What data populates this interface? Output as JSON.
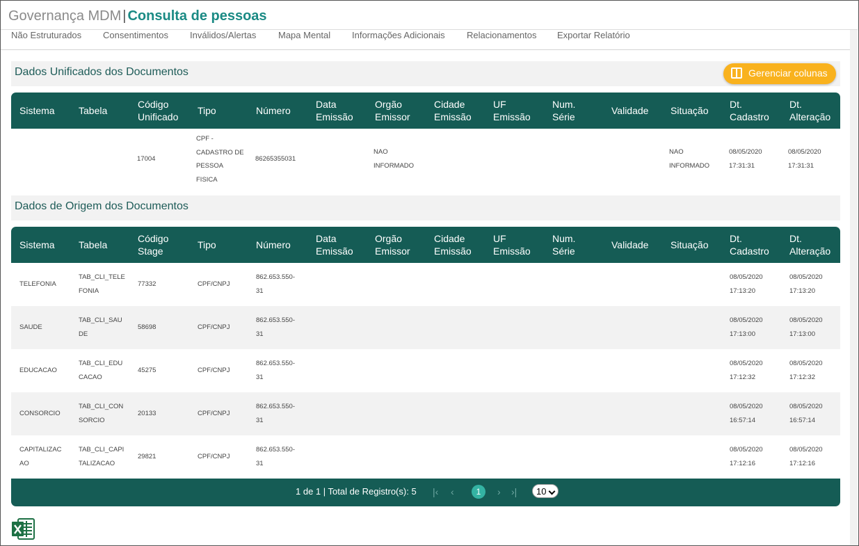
{
  "header": {
    "app_name": "Governança MDM",
    "separator": "|",
    "page_title": "Consulta de pessoas"
  },
  "nav": {
    "items": [
      {
        "label": "Não Estruturados"
      },
      {
        "label": "Consentimentos"
      },
      {
        "label": "Inválidos/Alertas"
      },
      {
        "label": "Mapa Mental"
      },
      {
        "label": "Informações Adicionais"
      },
      {
        "label": "Relacionamentos"
      },
      {
        "label": "Exportar Relatório"
      }
    ]
  },
  "unified": {
    "title": "Dados Unificados dos Documentos",
    "manage_columns_label": "Gerenciar colunas",
    "columns": [
      "Sistema",
      "Tabela",
      "Código\nUnificado",
      "Tipo",
      "Número",
      "Data\nEmissão",
      "Orgão\nEmissor",
      "Cidade\nEmissão",
      "UF\nEmissão",
      "Num.\nSérie",
      "Validade",
      "Situação",
      "Dt.\nCadastro",
      "Dt.\nAlteração"
    ],
    "rows": [
      [
        "",
        "",
        "17004",
        "CPF -\nCADASTRO DE\nPESSOA\nFISICA",
        "86265355031",
        "",
        "NAO\nINFORMADO",
        "",
        "",
        "",
        "",
        "NAO\nINFORMADO",
        "08/05/2020\n17:31:31",
        "08/05/2020\n17:31:31"
      ]
    ]
  },
  "origin": {
    "title": "Dados de Origem dos Documentos",
    "columns": [
      "Sistema",
      "Tabela",
      "Código\nStage",
      "Tipo",
      "Número",
      "Data\nEmissão",
      "Orgão\nEmissor",
      "Cidade\nEmissão",
      "UF\nEmissão",
      "Num.\nSérie",
      "Validade",
      "Situação",
      "Dt.\nCadastro",
      "Dt.\nAlteração"
    ],
    "rows": [
      [
        "TELEFONIA",
        "TAB_CLI_TELE\nFONIA",
        "77332",
        "CPF/CNPJ",
        "862.653.550-\n31",
        "",
        "",
        "",
        "",
        "",
        "",
        "",
        "08/05/2020\n17:13:20",
        "08/05/2020\n17:13:20"
      ],
      [
        "SAUDE",
        "TAB_CLI_SAU\nDE",
        "58698",
        "CPF/CNPJ",
        "862.653.550-\n31",
        "",
        "",
        "",
        "",
        "",
        "",
        "",
        "08/05/2020\n17:13:00",
        "08/05/2020\n17:13:00"
      ],
      [
        "EDUCACAO",
        "TAB_CLI_EDU\nCACAO",
        "45275",
        "CPF/CNPJ",
        "862.653.550-\n31",
        "",
        "",
        "",
        "",
        "",
        "",
        "",
        "08/05/2020\n17:12:32",
        "08/05/2020\n17:12:32"
      ],
      [
        "CONSORCIO",
        "TAB_CLI_CON\nSORCIO",
        "20133",
        "CPF/CNPJ",
        "862.653.550-\n31",
        "",
        "",
        "",
        "",
        "",
        "",
        "",
        "08/05/2020\n16:57:14",
        "08/05/2020\n16:57:14"
      ],
      [
        "CAPITALIZAC\nAO",
        "TAB_CLI_CAPI\nTALIZACAO",
        "29821",
        "CPF/CNPJ",
        "862.653.550-\n31",
        "",
        "",
        "",
        "",
        "",
        "",
        "",
        "08/05/2020\n17:12:16",
        "08/05/2020\n17:12:16"
      ]
    ]
  },
  "pagination": {
    "info": "1 de 1 | Total de Registro(s): 5",
    "current_page": "1",
    "page_size": "10",
    "first_icon": "first-page-icon",
    "prev_icon": "previous-page-icon",
    "next_icon": "next-page-icon",
    "last_icon": "last-page-icon"
  },
  "export": {
    "icon": "excel-export-icon"
  },
  "colors": {
    "brand_teal": "#1a8a84",
    "table_header": "#155c55",
    "accent_orange": "#f9b21e",
    "current_page": "#34b3a3"
  }
}
